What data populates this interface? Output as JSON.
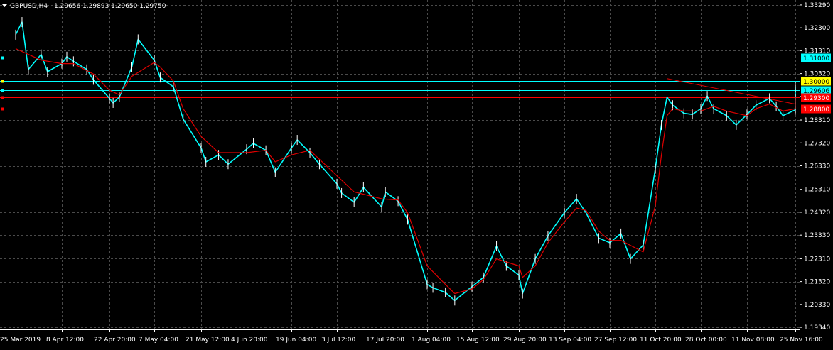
{
  "header": {
    "symbol_label": "GBPUSD,H4",
    "ohlc_text": "1.29656 1.29893 1.29650 1.29750"
  },
  "colors": {
    "background": "#000000",
    "grid": "#4a4a4a",
    "price_line": "#00ffff",
    "wick_white": "#ffffff",
    "moving_average": "#e00000",
    "level_cyan": "#00ffff",
    "level_yellow": "#ffff00",
    "level_red": "#ff0000"
  },
  "chart_data": {
    "type": "line",
    "title": "",
    "y_range": [
      1.1925,
      1.3338
    ],
    "y_ticks": [
      "1.33290",
      "1.32300",
      "1.31310",
      "1.30320",
      "1.29330",
      "1.28310",
      "1.27320",
      "1.26330",
      "1.25310",
      "1.24320",
      "1.23330",
      "1.22310",
      "1.21320",
      "1.20330",
      "1.19340"
    ],
    "x_ticks": [
      "25 Mar 2019",
      "8 Apr 12:00",
      "22 Apr 20:00",
      "7 May 04:00",
      "21 May 12:00",
      "4 Jun 20:00",
      "19 Jun 04:00",
      "3 Jul 12:00",
      "17 Jul 20:00",
      "1 Aug 04:00",
      "15 Aug 12:00",
      "29 Aug 20:00",
      "13 Sep 04:00",
      "27 Sep 12:00",
      "11 Oct 20:00",
      "28 Oct 00:00",
      "11 Nov 08:00",
      "25 Nov 16:00"
    ],
    "series": [
      {
        "type": "price",
        "points": [
          [
            "25 Mar 2019",
            1.32
          ],
          [
            "27 Mar",
            1.3255
          ],
          [
            "29 Mar",
            1.305
          ],
          [
            "2 Apr",
            1.3115
          ],
          [
            "4 Apr",
            1.304
          ],
          [
            "8 Apr 12:00",
            1.3075
          ],
          [
            "10 Apr",
            1.3105
          ],
          [
            "12 Apr",
            1.3085
          ],
          [
            "16 Apr",
            1.305
          ],
          [
            "18 Apr",
            1.3005
          ],
          [
            "22 Apr 20:00",
            1.2925
          ],
          [
            "24 Apr",
            1.2905
          ],
          [
            "26 Apr",
            1.293
          ],
          [
            "30 Apr",
            1.306
          ],
          [
            "2 May",
            1.318
          ],
          [
            "7 May 04:00",
            1.309
          ],
          [
            "9 May",
            1.3015
          ],
          [
            "13 May",
            1.2975
          ],
          [
            "16 May",
            1.2835
          ],
          [
            "21 May 12:00",
            1.271
          ],
          [
            "23 May",
            1.265
          ],
          [
            "27 May",
            1.268
          ],
          [
            "30 May",
            1.264
          ],
          [
            "4 Jun 20:00",
            1.2705
          ],
          [
            "7 Jun",
            1.273
          ],
          [
            "11 Jun",
            1.27
          ],
          [
            "14 Jun",
            1.2605
          ],
          [
            "19 Jun 04:00",
            1.271
          ],
          [
            "21 Jun",
            1.2745
          ],
          [
            "25 Jun",
            1.269
          ],
          [
            "28 Jun",
            1.264
          ],
          [
            "3 Jul 12:00",
            1.2555
          ],
          [
            "5 Jul",
            1.2515
          ],
          [
            "9 Jul",
            1.2475
          ],
          [
            "12 Jul",
            1.254
          ],
          [
            "17 Jul 20:00",
            1.2455
          ],
          [
            "19 Jul",
            1.252
          ],
          [
            "23 Jul",
            1.248
          ],
          [
            "26 Jul",
            1.24
          ],
          [
            "1 Aug 04:00",
            1.212
          ],
          [
            "3 Aug",
            1.2105
          ],
          [
            "7 Aug",
            1.2085
          ],
          [
            "10 Aug",
            1.205
          ],
          [
            "15 Aug 12:00",
            1.211
          ],
          [
            "19 Aug",
            1.215
          ],
          [
            "23 Aug",
            1.2285
          ],
          [
            "26 Aug",
            1.22
          ],
          [
            "29 Aug 20:00",
            1.216
          ],
          [
            "31 Aug",
            1.208
          ],
          [
            "4 Sep",
            1.223
          ],
          [
            "8 Sep",
            1.233
          ],
          [
            "13 Sep 04:00",
            1.243
          ],
          [
            "17 Sep",
            1.249
          ],
          [
            "20 Sep",
            1.243
          ],
          [
            "24 Sep",
            1.232
          ],
          [
            "27 Sep 12:00",
            1.23
          ],
          [
            "1 Oct",
            1.234
          ],
          [
            "4 Oct",
            1.223
          ],
          [
            "8 Oct",
            1.229
          ],
          [
            "11 Oct 20:00",
            1.262
          ],
          [
            "14 Oct",
            1.281
          ],
          [
            "16 Oct",
            1.293
          ],
          [
            "18 Oct",
            1.2895
          ],
          [
            "22 Oct",
            1.286
          ],
          [
            "25 Oct",
            1.2855
          ],
          [
            "28 Oct 00:00",
            1.288
          ],
          [
            "30 Oct",
            1.2935
          ],
          [
            "1 Nov",
            1.288
          ],
          [
            "5 Nov",
            1.285
          ],
          [
            "8 Nov",
            1.281
          ],
          [
            "11 Nov 08:00",
            1.2855
          ],
          [
            "14 Nov",
            1.2895
          ],
          [
            "18 Nov",
            1.2925
          ],
          [
            "20 Nov",
            1.289
          ],
          [
            "22 Nov",
            1.285
          ],
          [
            "25 Nov 16:00",
            1.2875
          ],
          [
            "27 Nov",
            1.292
          ],
          [
            "29 Nov",
            1.2975
          ]
        ]
      },
      {
        "type": "moving_average",
        "points": [
          [
            "25 Mar 2019",
            1.314
          ],
          [
            "2 Apr",
            1.309
          ],
          [
            "8 Apr 12:00",
            1.3075
          ],
          [
            "12 Apr",
            1.3075
          ],
          [
            "18 Apr",
            1.303
          ],
          [
            "22 Apr 20:00",
            1.296
          ],
          [
            "26 Apr",
            1.294
          ],
          [
            "30 Apr",
            1.302
          ],
          [
            "7 May 04:00",
            1.308
          ],
          [
            "9 May",
            1.306
          ],
          [
            "13 May",
            1.3
          ],
          [
            "16 May",
            1.288
          ],
          [
            "21 May 12:00",
            1.276
          ],
          [
            "27 May",
            1.269
          ],
          [
            "4 Jun 20:00",
            1.269
          ],
          [
            "11 Jun",
            1.27
          ],
          [
            "14 Jun",
            1.265
          ],
          [
            "19 Jun 04:00",
            1.268
          ],
          [
            "25 Jun",
            1.27
          ],
          [
            "3 Jul 12:00",
            1.259
          ],
          [
            "9 Jul",
            1.252
          ],
          [
            "12 Jul",
            1.251
          ],
          [
            "17 Jul 20:00",
            1.249
          ],
          [
            "23 Jul",
            1.2485
          ],
          [
            "26 Jul",
            1.243
          ],
          [
            "1 Aug 04:00",
            1.22
          ],
          [
            "7 Aug",
            1.212
          ],
          [
            "10 Aug",
            1.208
          ],
          [
            "15 Aug 12:00",
            1.21
          ],
          [
            "19 Aug",
            1.214
          ],
          [
            "23 Aug",
            1.223
          ],
          [
            "29 Aug 20:00",
            1.22
          ],
          [
            "31 Aug",
            1.215
          ],
          [
            "4 Sep",
            1.22
          ],
          [
            "8 Sep",
            1.23
          ],
          [
            "13 Sep 04:00",
            1.239
          ],
          [
            "17 Sep",
            1.245
          ],
          [
            "20 Sep",
            1.244
          ],
          [
            "24 Sep",
            1.235
          ],
          [
            "27 Sep 12:00",
            1.231
          ],
          [
            "1 Oct",
            1.231
          ],
          [
            "8 Oct",
            1.226
          ],
          [
            "11 Oct 20:00",
            1.246
          ],
          [
            "14 Oct",
            1.268
          ],
          [
            "16 Oct",
            1.285
          ],
          [
            "18 Oct",
            1.288
          ],
          [
            "22 Oct",
            1.287
          ],
          [
            "28 Oct 00:00",
            1.287
          ],
          [
            "1 Nov",
            1.289
          ],
          [
            "5 Nov",
            1.287
          ],
          [
            "11 Nov 08:00",
            1.285
          ],
          [
            "14 Nov",
            1.288
          ],
          [
            "18 Nov",
            1.29
          ],
          [
            "22 Nov",
            1.287
          ],
          [
            "25 Nov 16:00",
            1.288
          ],
          [
            "29 Nov",
            1.293
          ]
        ]
      }
    ],
    "trendline": {
      "color": "#e00000",
      "from": [
        "16 Oct",
        1.301
      ],
      "to": [
        "29 Nov",
        1.29
      ]
    },
    "horizontal_levels": [
      {
        "label": "1.31000",
        "value": 1.31,
        "color": "#00ffff",
        "text_color": "#000000"
      },
      {
        "label": "1.30000",
        "value": 1.3,
        "color": "#ffff00",
        "text_color": "#000000",
        "line_color": "#00ffff"
      },
      {
        "label": "1.29606",
        "value": 1.2961,
        "color": "#00ffff",
        "text_color": "#000000",
        "line_color": "#00ffff"
      },
      {
        "label": "1.29300",
        "value": 1.293,
        "color": "#ff0000",
        "text_color": "#ffffff"
      },
      {
        "label": "1.28800",
        "value": 1.288,
        "color": "#ff0000",
        "text_color": "#ffffff"
      }
    ],
    "grid": true,
    "legend": "none"
  }
}
